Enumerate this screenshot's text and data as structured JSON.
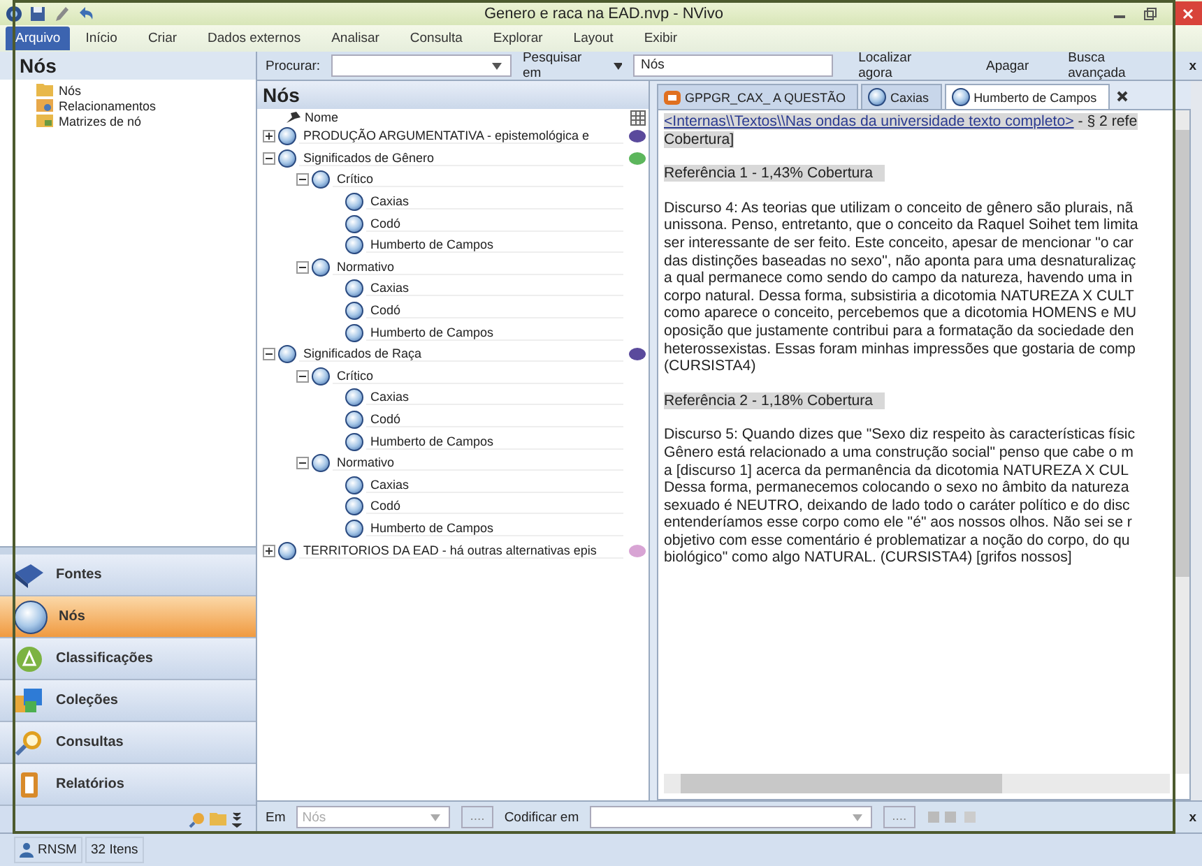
{
  "window": {
    "title": "Genero e raca na EAD.nvp - NVivo"
  },
  "ribbon_tabs": [
    {
      "label": "Arquivo",
      "selected": true
    },
    {
      "label": "Início",
      "selected": false
    },
    {
      "label": "Criar",
      "selected": false
    },
    {
      "label": "Dados externos",
      "selected": false
    },
    {
      "label": "Analisar",
      "selected": false
    },
    {
      "label": "Consulta",
      "selected": false
    },
    {
      "label": "Explorar",
      "selected": false
    },
    {
      "label": "Layout",
      "selected": false
    },
    {
      "label": "Exibir",
      "selected": false
    }
  ],
  "navigation": {
    "title": "Nós",
    "tree": [
      {
        "label": "Nós",
        "kind": "folder"
      },
      {
        "label": "Relacionamentos",
        "kind": "relationship"
      },
      {
        "label": "Matrizes de nó",
        "kind": "matrix"
      }
    ],
    "sections": [
      {
        "label": "Fontes",
        "kind": "sources",
        "selected": false
      },
      {
        "label": "Nós",
        "kind": "nodes",
        "selected": true
      },
      {
        "label": "Classificações",
        "kind": "classifications",
        "selected": false
      },
      {
        "label": "Coleções",
        "kind": "collections",
        "selected": false
      },
      {
        "label": "Consultas",
        "kind": "queries",
        "selected": false
      },
      {
        "label": "Relatórios",
        "kind": "reports",
        "selected": false
      }
    ]
  },
  "find_bar": {
    "label": "Procurar:",
    "search_in_label": "Pesquisar em",
    "search_in_value": "Nós",
    "buttons": [
      "Localizar agora",
      "Apagar",
      "Busca avançada"
    ],
    "close": "x"
  },
  "nodes_panel": {
    "title": "Nós",
    "column": "Nome",
    "nodes": [
      {
        "name": "PRODUÇÃO ARGUMENTATIVA - epistemológica e",
        "color": "#5a4a9c",
        "expanded": false
      },
      {
        "name": "Significados de Gênero",
        "color": "#5cb65c",
        "expanded": true,
        "children": [
          {
            "name": "Crítico",
            "expanded": true,
            "children": [
              {
                "name": "Caxias"
              },
              {
                "name": "Codó"
              },
              {
                "name": "Humberto de Campos"
              }
            ]
          },
          {
            "name": "Normativo",
            "expanded": true,
            "children": [
              {
                "name": "Caxias"
              },
              {
                "name": "Codó"
              },
              {
                "name": "Humberto de Campos"
              }
            ]
          }
        ]
      },
      {
        "name": "Significados de Raça",
        "color": "#5a4a9c",
        "expanded": true,
        "children": [
          {
            "name": "Crítico",
            "expanded": true,
            "children": [
              {
                "name": "Caxias"
              },
              {
                "name": "Codó"
              },
              {
                "name": "Humberto de Campos"
              }
            ]
          },
          {
            "name": "Normativo",
            "expanded": true,
            "children": [
              {
                "name": "Caxias"
              },
              {
                "name": "Codó"
              },
              {
                "name": "Humberto de Campos"
              }
            ]
          }
        ]
      },
      {
        "name": "TERRITORIOS DA EAD -  há outras alternativas epis",
        "color": "#d8a4d4",
        "expanded": false
      }
    ]
  },
  "detail_tabs": [
    {
      "label": "GPPGR_CAX_ A QUESTÃO",
      "kind": "document",
      "selected": false
    },
    {
      "label": "Caxias",
      "kind": "node",
      "selected": false
    },
    {
      "label": "Humberto de Campos",
      "kind": "node",
      "selected": true
    }
  ],
  "detail": {
    "source_link": "<Internas\\\\Textos\\\\Nas ondas da universidade texto completo>",
    "source_rest": " - § 2 refe",
    "source_line2": "Cobertura]",
    "references": [
      {
        "heading": "Referência 1 - 1,43% Cobertura",
        "lines": [
          "Discurso 4: As teorias que utilizam o conceito de gênero são plurais, nã",
          "unissona. Penso, entretanto, que o conceito da Raquel Soihet tem limita",
          "ser interessante de ser feito. Este conceito, apesar de mencionar \"o car",
          "das distinções baseadas no sexo\", não aponta para uma desnaturalizaç",
          "a qual permanece como sendo do campo da natureza, havendo uma in",
          "corpo natural. Dessa forma, subsistiria a dicotomia NATUREZA X CULT",
          "como aparece o conceito, percebemos que a dicotomia HOMENS e MU",
          "oposição que justamente contribui para a formatação da sociedade den",
          "heterossexistas. Essas foram minhas impressões que gostaria de comp",
          "(CURSISTA4)"
        ]
      },
      {
        "heading": "Referência 2 - 1,18% Cobertura",
        "lines": [
          "Discurso 5: Quando dizes que \"Sexo diz respeito às características físic",
          "Gênero está relacionado a uma construção social\" penso que cabe o m",
          "a [discurso 1] acerca da permanência da dicotomia NATUREZA X CUL",
          "Dessa forma, permanecemos colocando o sexo no âmbito da natureza",
          "sexuado é NEUTRO, deixando de lado todo o caráter político e do disc",
          "entenderíamos esse corpo como ele \"é\" aos nossos olhos. Não sei se r",
          "objetivo com esse comentário é problematizar a noção do corpo, do qu",
          "biológico\" como algo NATURAL. (CURSISTA4) [grifos nossos]"
        ]
      }
    ]
  },
  "coding_bar": {
    "in_label": "Em",
    "in_value": "Nós",
    "browse": "....",
    "code_label": "Codificar em",
    "browse2": "....",
    "close": "x"
  },
  "status_bar": {
    "user": "RNSM",
    "count": "32 Itens"
  }
}
